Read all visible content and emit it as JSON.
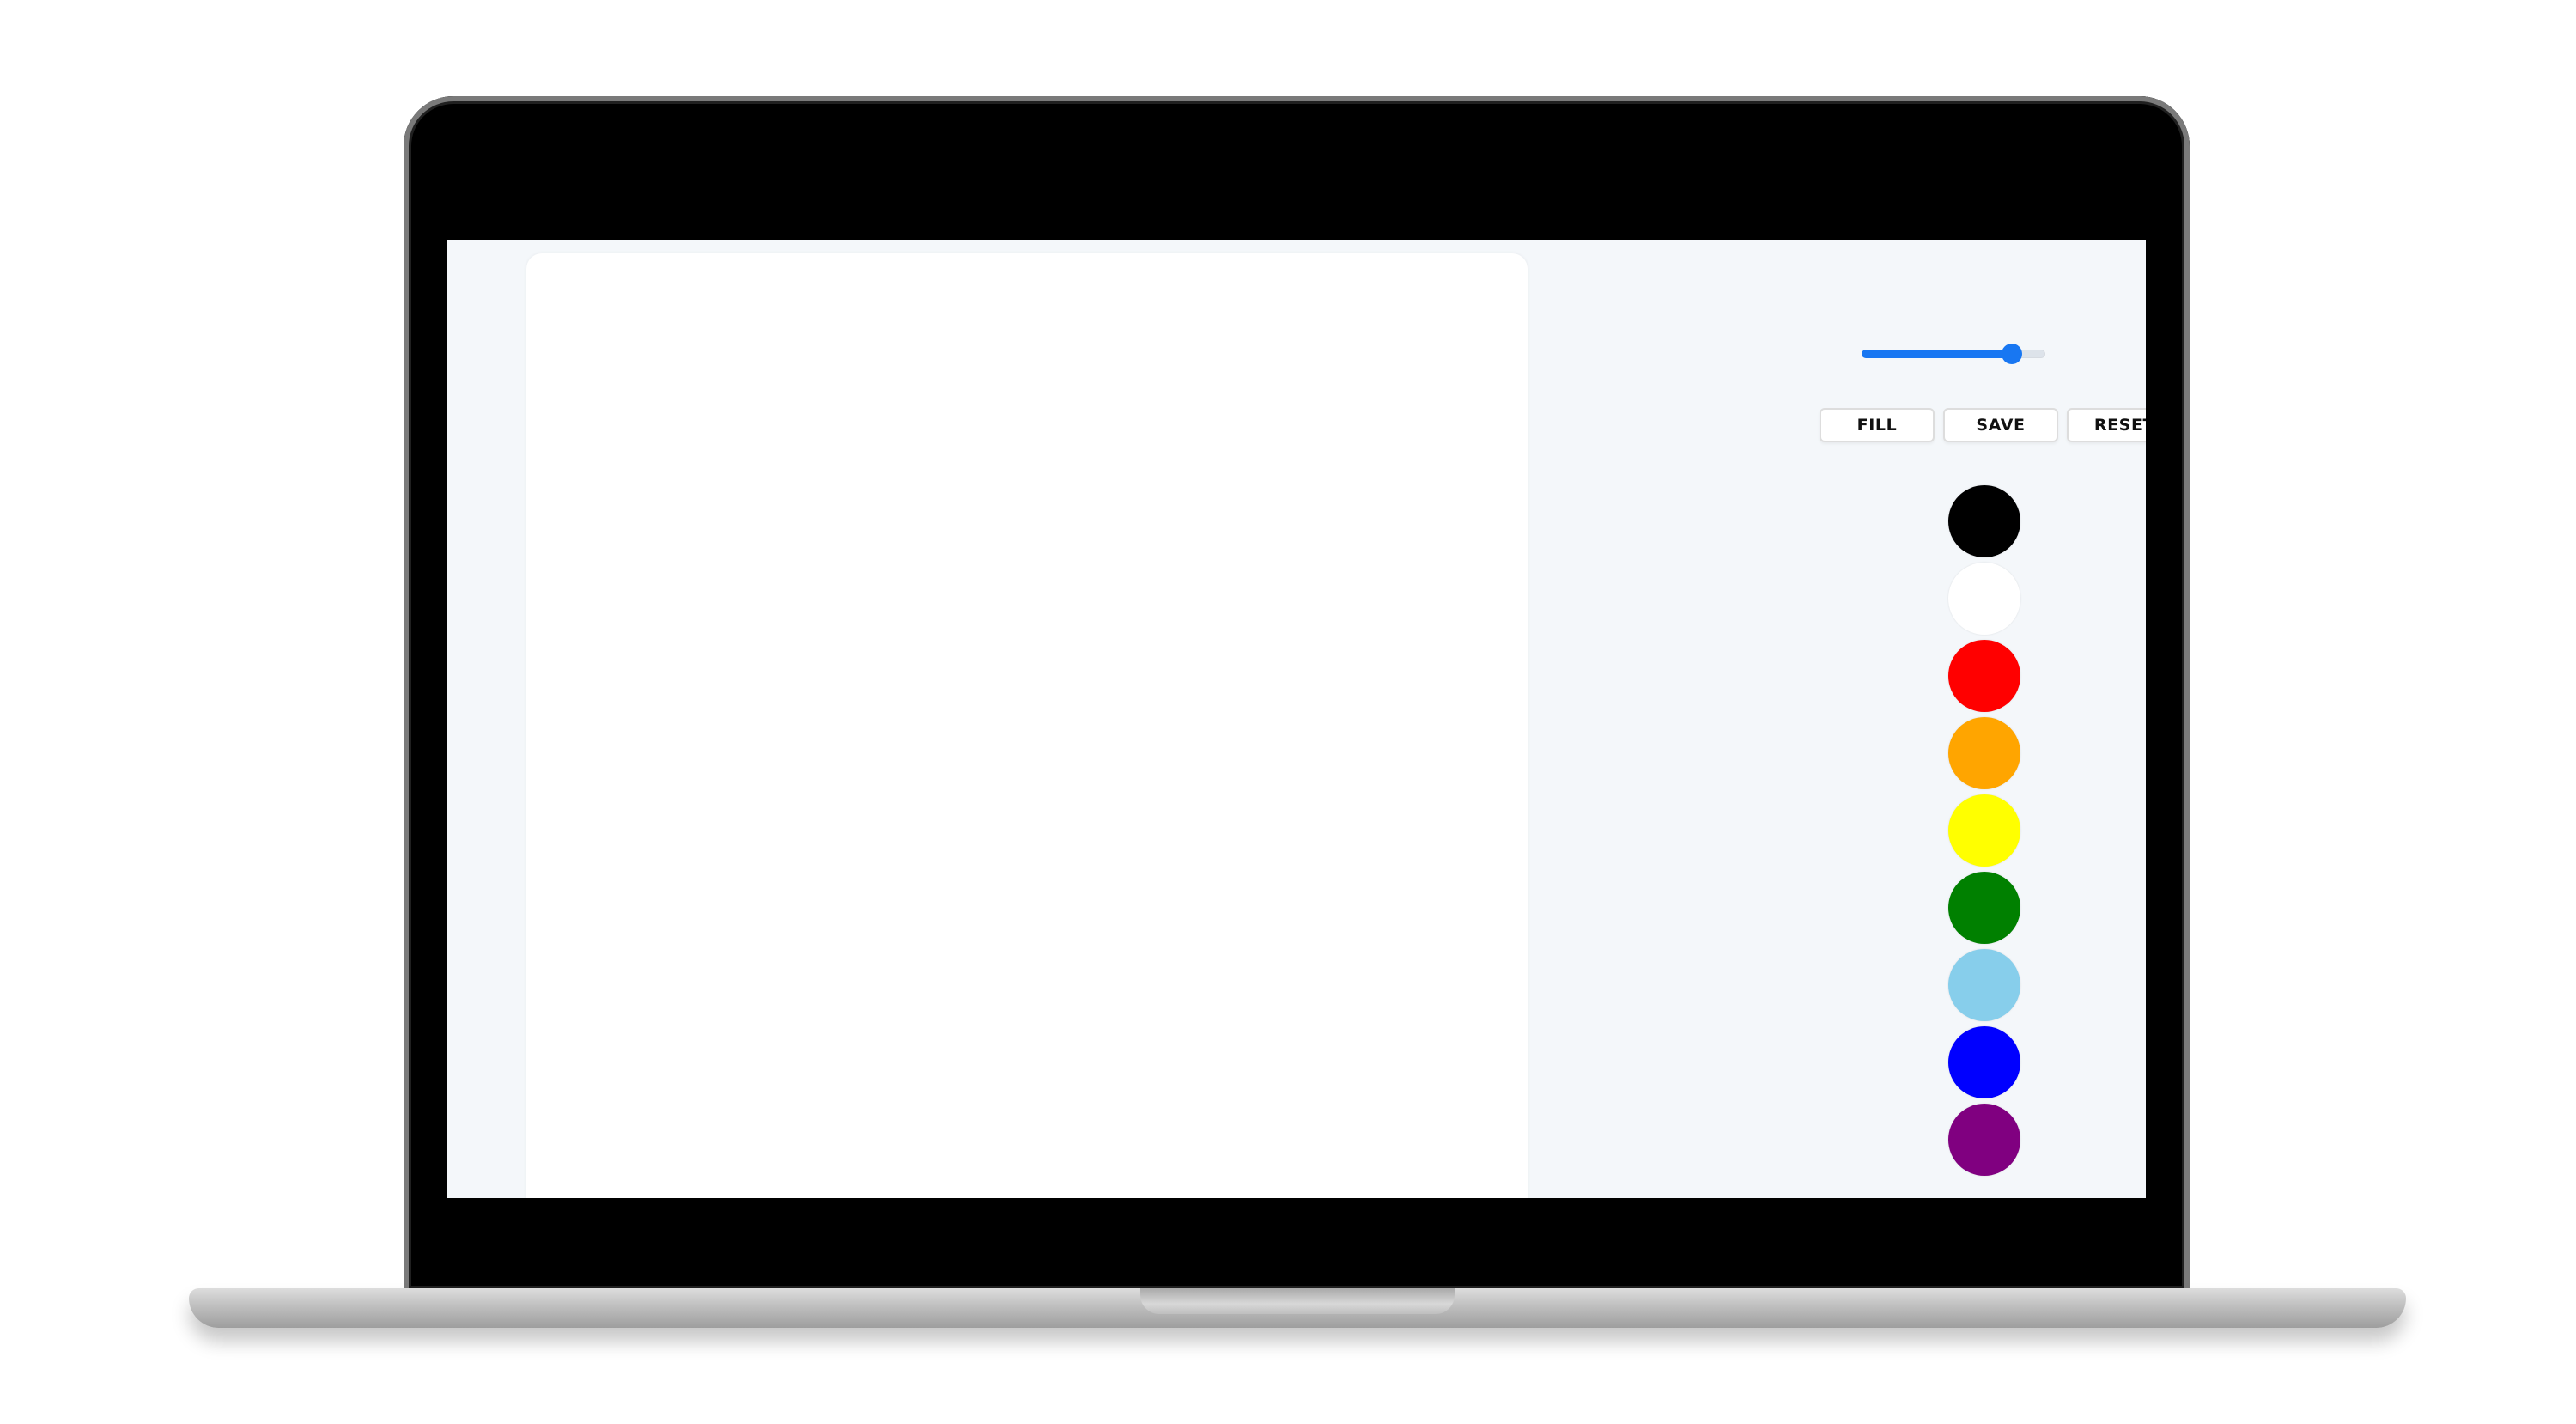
{
  "toolbar": {
    "brush_size_percent": 82,
    "fill_label": "FILL",
    "save_label": "SAVE",
    "reset_label": "RESET"
  },
  "palette": {
    "colors": [
      {
        "name": "black-swatch",
        "hex": "#000000"
      },
      {
        "name": "white-swatch",
        "hex": "#ffffff"
      },
      {
        "name": "red-swatch",
        "hex": "#ff0000"
      },
      {
        "name": "orange-swatch",
        "hex": "#ffa500"
      },
      {
        "name": "yellow-swatch",
        "hex": "#ffff00"
      },
      {
        "name": "green-swatch",
        "hex": "#008000"
      },
      {
        "name": "light-blue-swatch",
        "hex": "#87ceeb"
      },
      {
        "name": "blue-swatch",
        "hex": "#0000ff"
      },
      {
        "name": "purple-swatch",
        "hex": "#800080"
      }
    ]
  }
}
